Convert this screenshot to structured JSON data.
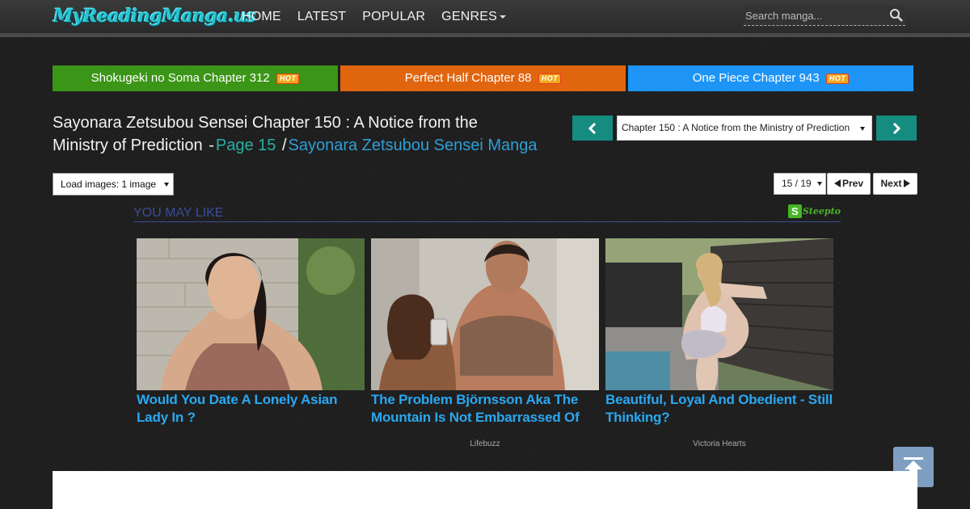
{
  "header": {
    "logo_text": "MyReadingManga.us",
    "nav": [
      "HOME",
      "LATEST",
      "POPULAR",
      "GENRES"
    ],
    "search_placeholder": "Search manga..."
  },
  "hot_bars": [
    {
      "label": "Shokugeki no Soma Chapter 312",
      "badge": "HOT",
      "color": "#3b9517"
    },
    {
      "label": "Perfect Half Chapter 88",
      "badge": "HOT",
      "color": "#e1650f"
    },
    {
      "label": "One Piece Chapter 943",
      "badge": "HOT",
      "color": "#1e95f6"
    }
  ],
  "title": {
    "chapter": "Sayonara Zetsubou Sensei Chapter 150 : A Notice from the Ministry of Prediction",
    "dash": "-",
    "page_link": "Page 15",
    "slash": "/",
    "manga_link": "Sayonara Zetsubou Sensei Manga"
  },
  "chapter_nav": {
    "selected": "Chapter 150 : A Notice from the Ministry of Prediction"
  },
  "reader_controls": {
    "load_images": "Load images: 1 image",
    "page_select": "15 / 19",
    "prev": "Prev",
    "next": "Next"
  },
  "you_may_like": {
    "title": "YOU MAY LIKE",
    "sponsor": "Steepto",
    "cards": [
      {
        "caption": "Would You Date A Lonely Asian Lady In ?",
        "source": ""
      },
      {
        "caption": "The Problem Björnsson Aka The Mountain Is Not Embarrassed Of",
        "source": "Lifebuzz"
      },
      {
        "caption": "Beautiful, Loyal And Obedient - Still Thinking?",
        "source": "Victoria Hearts"
      }
    ]
  }
}
